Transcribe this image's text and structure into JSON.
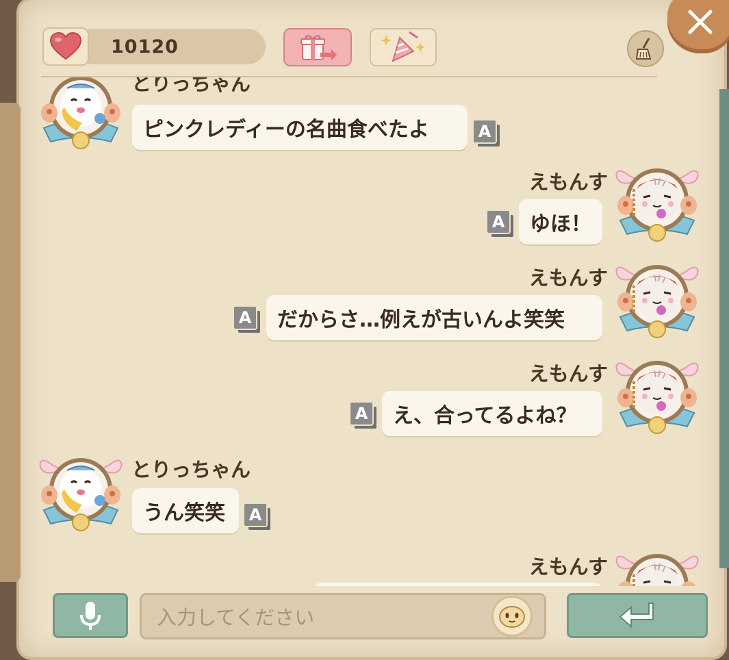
{
  "header": {
    "hearts": "10120"
  },
  "input": {
    "placeholder": "入力してください"
  },
  "messages": [
    {
      "sender": "とりっちゃん",
      "text": "ピンクレディーの名曲食べたよ",
      "side": "left",
      "badge": "A"
    },
    {
      "sender": "えもんす",
      "text": "ゆほ！",
      "side": "right",
      "badge": "A"
    },
    {
      "sender": "えもんす",
      "text": "だからさ…例えが古いんよ笑笑",
      "side": "right",
      "badge": "A"
    },
    {
      "sender": "えもんす",
      "text": "え、合ってるよね？",
      "side": "right",
      "badge": "A"
    },
    {
      "sender": "とりっちゃん",
      "text": "うん笑笑",
      "side": "left",
      "badge": "A"
    },
    {
      "sender": "えもんす",
      "text": "",
      "side": "right",
      "badge": ""
    }
  ],
  "icons": {
    "heart": "heart-icon",
    "gift": "gift-send-icon",
    "party": "party-popper-icon",
    "broom": "broom-icon",
    "close": "close-icon",
    "mic": "microphone-icon",
    "emoji": "emoji-face-icon",
    "send": "enter-arrow-icon"
  },
  "colors": {
    "panel_bg": "#ede1c8",
    "accent_green": "#8fb7a4",
    "gift_pink": "#f3b2b4",
    "text_dark": "#3b2a1e"
  }
}
